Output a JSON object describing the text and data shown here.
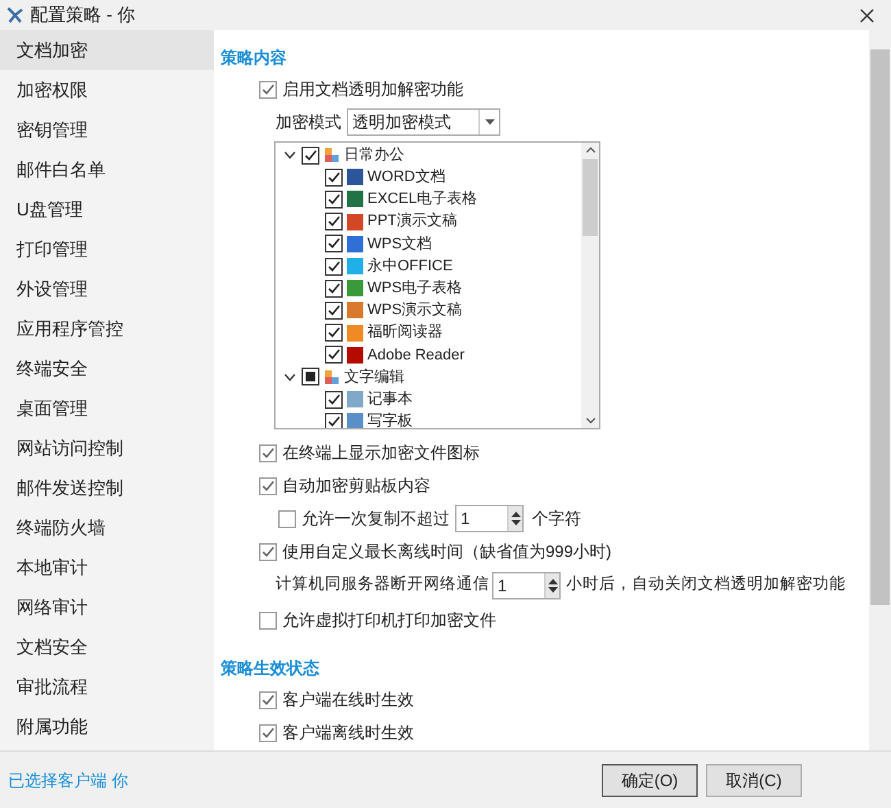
{
  "window": {
    "title": "配置策略 - 你"
  },
  "sidebar": {
    "items": [
      {
        "label": "文档加密",
        "selected": true
      },
      {
        "label": "加密权限",
        "selected": false
      },
      {
        "label": "密钥管理",
        "selected": false
      },
      {
        "label": "邮件白名单",
        "selected": false
      },
      {
        "label": "U盘管理",
        "selected": false
      },
      {
        "label": "打印管理",
        "selected": false
      },
      {
        "label": "外设管理",
        "selected": false
      },
      {
        "label": "应用程序管控",
        "selected": false
      },
      {
        "label": "终端安全",
        "selected": false
      },
      {
        "label": "桌面管理",
        "selected": false
      },
      {
        "label": "网站访问控制",
        "selected": false
      },
      {
        "label": "邮件发送控制",
        "selected": false
      },
      {
        "label": "终端防火墙",
        "selected": false
      },
      {
        "label": "本地审计",
        "selected": false
      },
      {
        "label": "网络审计",
        "selected": false
      },
      {
        "label": "文档安全",
        "selected": false
      },
      {
        "label": "审批流程",
        "selected": false
      },
      {
        "label": "附属功能",
        "selected": false
      }
    ]
  },
  "sections": [
    {
      "title": "策略内容",
      "items": [
        {
          "kind": "checkbox",
          "label": "启用文档透明加解密功能",
          "checked": true
        },
        {
          "kind": "select",
          "label": "加密模式",
          "value": "透明加密模式"
        },
        {
          "kind": "tree",
          "nodes": [
            {
              "label": "日常办公",
              "checked": true,
              "indeterminate": false,
              "expanded": true,
              "children": [
                {
                  "label": "WORD文档",
                  "checked": true,
                  "color": "#2b579a"
                },
                {
                  "label": "EXCEL电子表格",
                  "checked": true,
                  "color": "#217346"
                },
                {
                  "label": "PPT演示文稿",
                  "checked": true,
                  "color": "#d24726"
                },
                {
                  "label": "WPS文档",
                  "checked": true,
                  "color": "#2f6fd6"
                },
                {
                  "label": "永中OFFICE",
                  "checked": true,
                  "color": "#1fb0e8"
                },
                {
                  "label": "WPS电子表格",
                  "checked": true,
                  "color": "#3a9a3a"
                },
                {
                  "label": "WPS演示文稿",
                  "checked": true,
                  "color": "#d9792c"
                },
                {
                  "label": "福昕阅读器",
                  "checked": true,
                  "color": "#f08a24"
                },
                {
                  "label": "Adobe Reader",
                  "checked": true,
                  "color": "#b30b00"
                }
              ]
            },
            {
              "label": "文字编辑",
              "checked": false,
              "indeterminate": true,
              "expanded": true,
              "children": [
                {
                  "label": "记事本",
                  "checked": true,
                  "color": "#7fa8c9"
                },
                {
                  "label": "写字板",
                  "checked": true,
                  "color": "#5b8fc7"
                }
              ]
            }
          ]
        },
        {
          "kind": "checkbox",
          "label": "在终端上显示加密文件图标",
          "checked": true
        },
        {
          "kind": "checkbox",
          "label": "自动加密剪贴板内容",
          "checked": true
        },
        {
          "kind": "spin-checkbox",
          "label": "允许一次复制不超过",
          "checked": false,
          "value": "1",
          "suffix": "个字符"
        },
        {
          "kind": "checkbox",
          "label": "使用自定义最长离线时间（缺省值为999小时)",
          "checked": true
        },
        {
          "kind": "spin",
          "label": "计算机同服务器断开网络通信",
          "value": "1",
          "suffix": "小时后，自动关闭文档透明加解密功能"
        },
        {
          "kind": "checkbox",
          "label": "允许虚拟打印机打印加密文件",
          "checked": false
        }
      ]
    },
    {
      "title": "策略生效状态",
      "items": [
        {
          "kind": "checkbox",
          "label": "客户端在线时生效",
          "checked": true
        },
        {
          "kind": "checkbox",
          "label": "客户端离线时生效",
          "checked": true
        }
      ]
    }
  ],
  "status": "已选择客户端 你",
  "buttons": [
    "确定(O)",
    "取消(C)"
  ]
}
